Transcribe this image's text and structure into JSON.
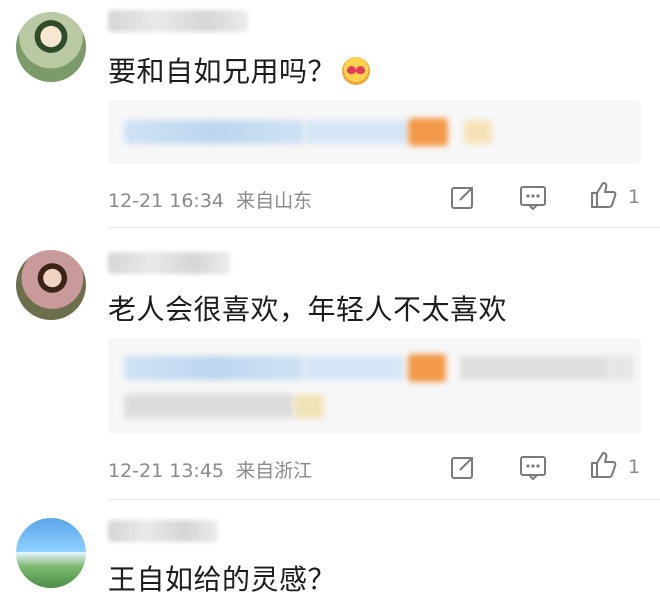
{
  "comments": [
    {
      "text": "要和自如兄用吗？",
      "emoji": "heart-eyes-emoji",
      "time": "12-21 16:34",
      "location": "来自山东",
      "likes": "1"
    },
    {
      "text": "老人会很喜欢，年轻人不太喜欢",
      "time": "12-21 13:45",
      "location": "来自浙江",
      "likes": "1"
    },
    {
      "text": "王自如给的灵感？"
    }
  ]
}
